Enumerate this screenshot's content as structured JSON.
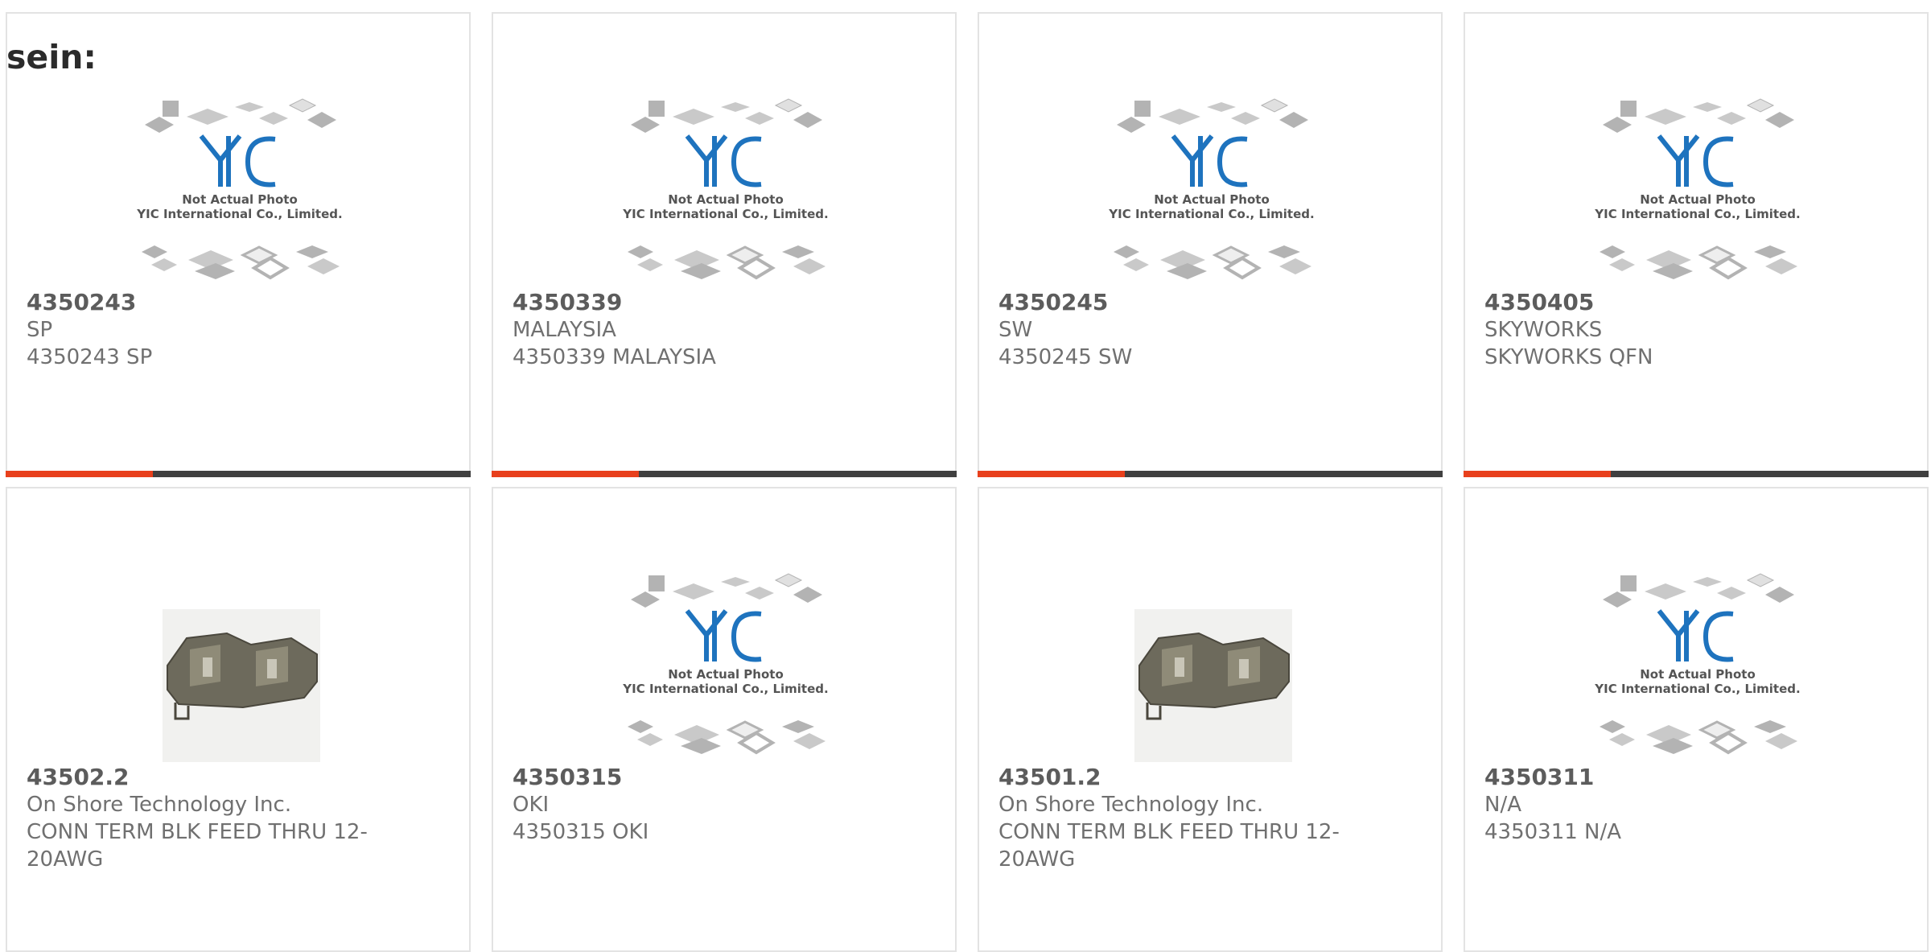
{
  "page": {
    "heading": "sein:"
  },
  "colors": {
    "accent": "#e8401c",
    "bar": "#404040",
    "logo": "#1e73be"
  },
  "placeholder_logo": {
    "brand": "YIC",
    "caption_line1": "Not Actual Photo",
    "caption_line2": "YIC International Co., Limited."
  },
  "cards": [
    {
      "part_number": "4350243",
      "manufacturer": "SP",
      "description": "4350243 SP",
      "image": "placeholder"
    },
    {
      "part_number": "4350339",
      "manufacturer": "MALAYSIA",
      "description": "4350339 MALAYSIA",
      "image": "placeholder"
    },
    {
      "part_number": "4350245",
      "manufacturer": "SW",
      "description": "4350245 SW",
      "image": "placeholder"
    },
    {
      "part_number": "4350405",
      "manufacturer": "SKYWORKS",
      "description": "SKYWORKS QFN",
      "image": "placeholder"
    },
    {
      "part_number": "43502.2",
      "manufacturer": "On Shore Technology Inc.",
      "description": "CONN TERM BLK FEED THRU 12-20AWG",
      "image": "terminal-block"
    },
    {
      "part_number": "4350315",
      "manufacturer": "OKI",
      "description": "4350315 OKI",
      "image": "placeholder"
    },
    {
      "part_number": "43501.2",
      "manufacturer": "On Shore Technology Inc.",
      "description": "CONN TERM BLK FEED THRU 12-20AWG",
      "image": "terminal-block"
    },
    {
      "part_number": "4350311",
      "manufacturer": "N/A",
      "description": "4350311 N/A",
      "image": "placeholder"
    }
  ]
}
